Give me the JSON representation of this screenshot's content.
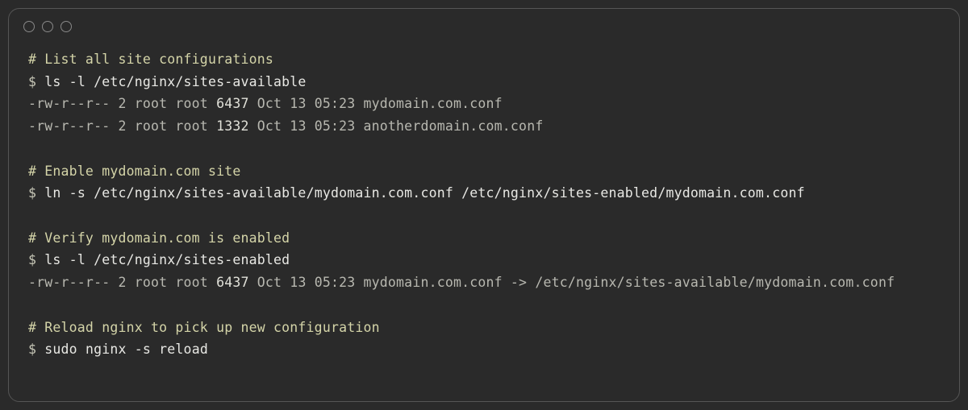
{
  "blocks": [
    {
      "comment": "# List all site configurations",
      "prompt": "$ ",
      "command": "ls -l /etc/nginx/sites-available",
      "output": [
        {
          "perm": "-rw-r--r-- 2 root root ",
          "size": "6437",
          "rest": " Oct 13 05:23 mydomain.com.conf"
        },
        {
          "perm": "-rw-r--r-- 2 root root ",
          "size": "1332",
          "rest": " Oct 13 05:23 anotherdomain.com.conf"
        }
      ]
    },
    {
      "comment": "# Enable mydomain.com site",
      "prompt": "$ ",
      "command": "ln -s /etc/nginx/sites-available/mydomain.com.conf /etc/nginx/sites-enabled/mydomain.com.conf",
      "output": []
    },
    {
      "comment": "# Verify mydomain.com is enabled",
      "prompt": "$ ",
      "command": "ls -l /etc/nginx/sites-enabled",
      "output": [
        {
          "perm": "-rw-r--r-- 2 root root ",
          "size": "6437",
          "rest": " Oct 13 05:23 mydomain.com.conf -> /etc/nginx/sites-available/mydomain.com.conf"
        }
      ]
    },
    {
      "comment": "# Reload nginx to pick up new configuration",
      "prompt": "$ ",
      "command": "sudo nginx -s reload",
      "output": []
    }
  ]
}
